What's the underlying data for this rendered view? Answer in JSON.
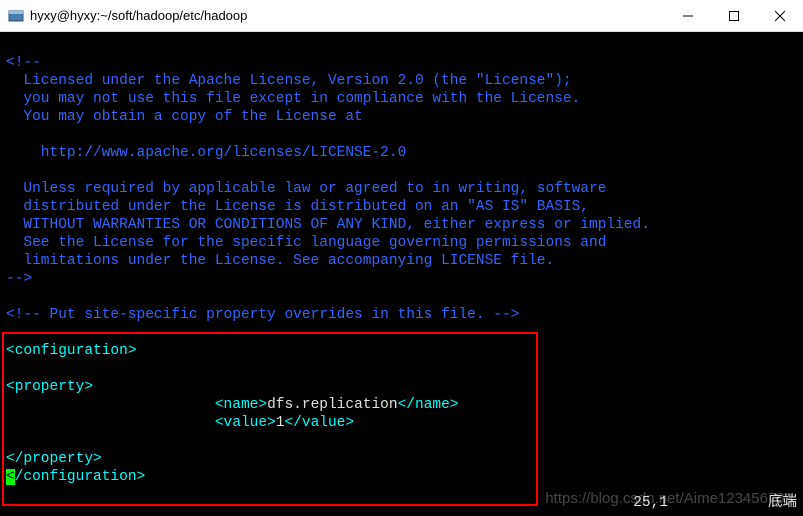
{
  "window": {
    "title": "hyxy@hyxy:~/soft/hadoop/etc/hadoop"
  },
  "terminal": {
    "comment_open": "<!--",
    "license_lines": [
      "  Licensed under the Apache License, Version 2.0 (the \"License\");",
      "  you may not use this file except in compliance with the License.",
      "  You may obtain a copy of the License at",
      "",
      "    http://www.apache.org/licenses/LICENSE-2.0",
      "",
      "  Unless required by applicable law or agreed to in writing, software",
      "  distributed under the License is distributed on an \"AS IS\" BASIS,",
      "  WITHOUT WARRANTIES OR CONDITIONS OF ANY KIND, either express or implied.",
      "  See the License for the specific language governing permissions and",
      "  limitations under the License. See accompanying LICENSE file."
    ],
    "comment_close": "-->",
    "site_comment": "<!-- Put site-specific property overrides in this file. -->",
    "config_open": "<configuration>",
    "property_open": "<property>",
    "name_open": "<name>",
    "name_value": "dfs.replication",
    "name_close": "</name>",
    "value_open": "<value>",
    "value_value": "1",
    "value_close": "</value>",
    "property_close": "</property>",
    "cursor_char": "<",
    "config_close_rest": "/configuration>",
    "indent_name": "                        ",
    "indent_value": "                        "
  },
  "status": {
    "position": "25,1",
    "location": "底端"
  },
  "watermark": "https://blog.csdn.net/Aime123456789"
}
